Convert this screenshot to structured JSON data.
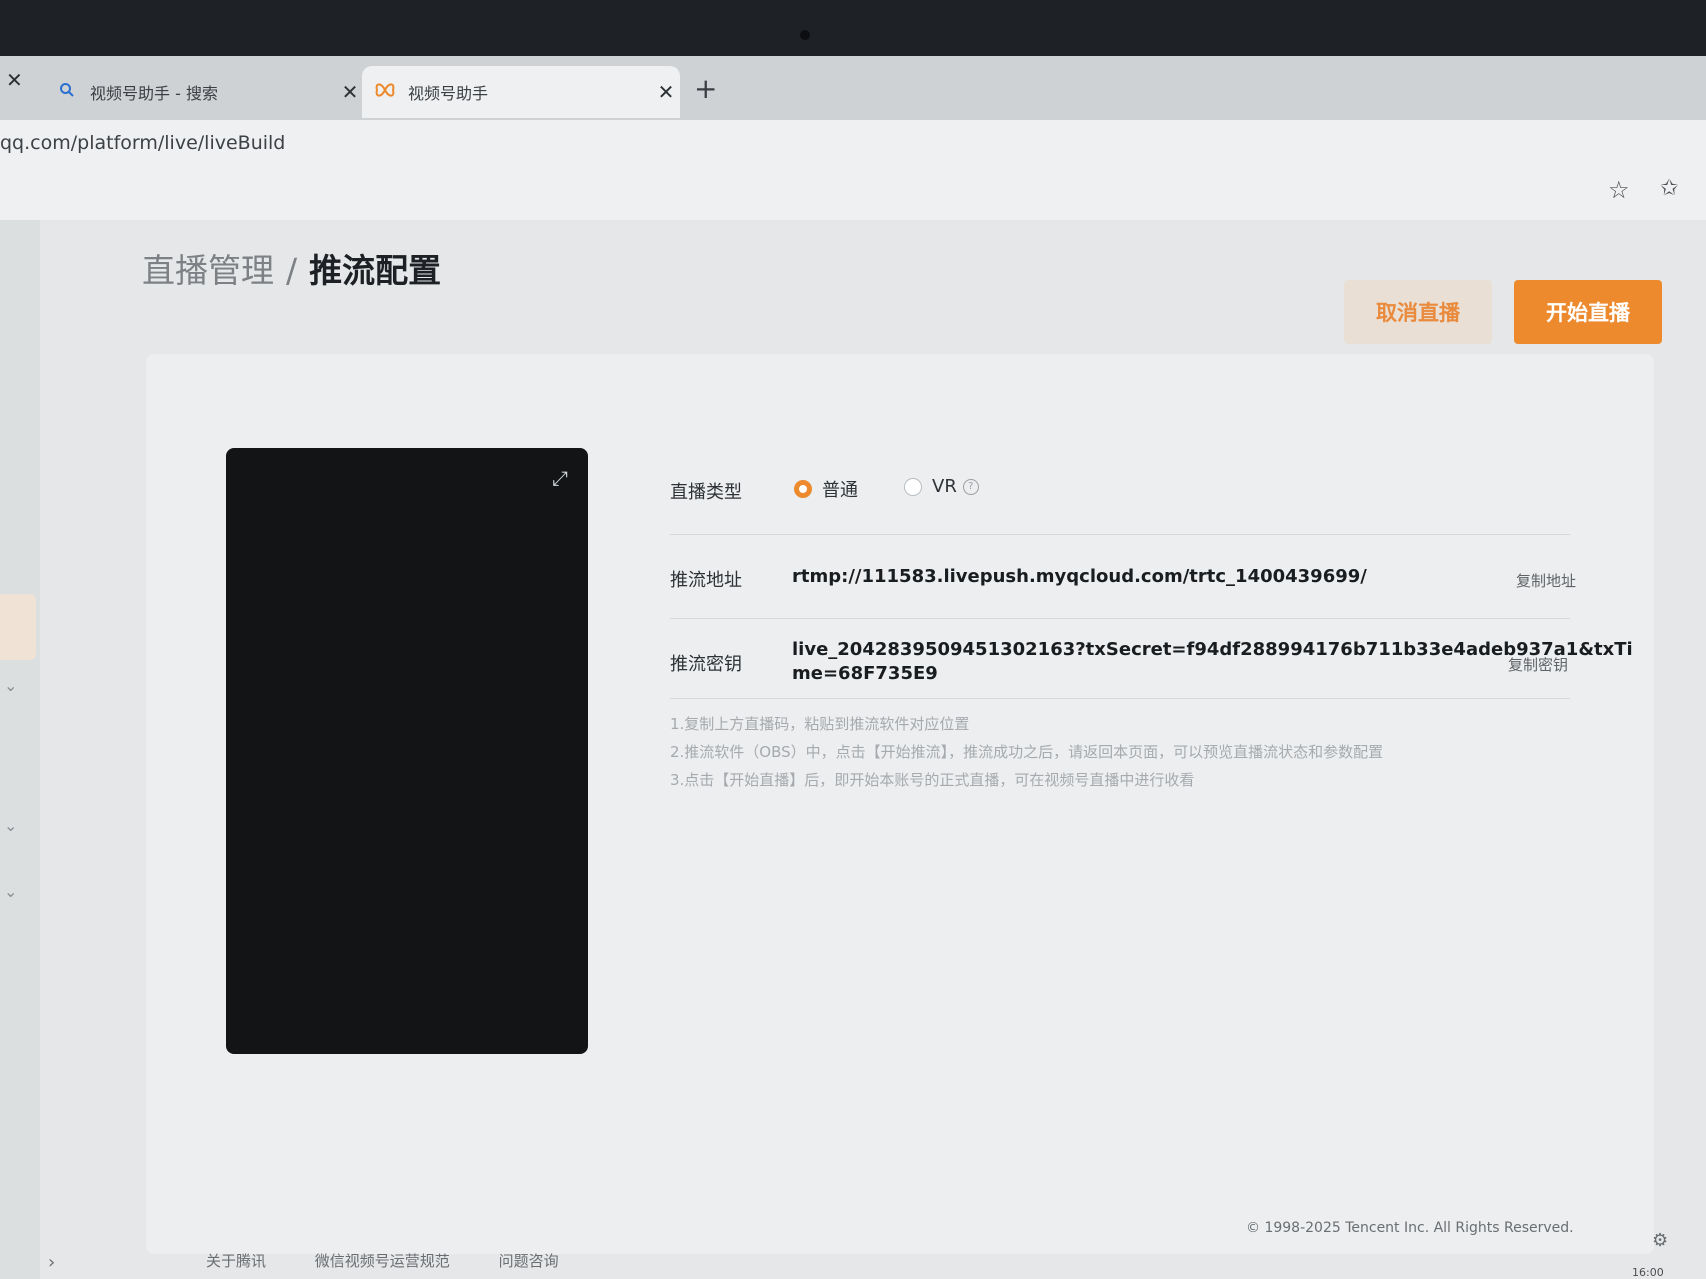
{
  "browser": {
    "tabs": [
      {
        "label": "视频号助手 - 搜索",
        "icon": "search-icon",
        "active": false
      },
      {
        "label": "视频号助手",
        "icon": "butterfly-logo-icon",
        "active": true
      }
    ],
    "url": "qq.com/platform/live/liveBuild"
  },
  "page": {
    "breadcrumb": {
      "parent": "直播管理",
      "separator": "/",
      "current": "推流配置"
    },
    "buttons": {
      "cancel": "取消直播",
      "start": "开始直播"
    },
    "live_type": {
      "label": "直播类型",
      "options": [
        {
          "label": "普通",
          "selected": true
        },
        {
          "label": "VR",
          "selected": false
        }
      ]
    },
    "push_url": {
      "label": "推流地址",
      "value": "rtmp://111583.livepush.myqcloud.com/trtc_1400439699/",
      "copy_label": "复制地址"
    },
    "push_key": {
      "label": "推流密钥",
      "value_line1": "live_2042839509451302163?txSecret=f94df288994176b711b33e4adeb937a1&txTi",
      "value_line2": "me=68F735E9",
      "copy_label": "复制密钥"
    },
    "tips": [
      "1.复制上方直播码，粘贴到推流软件对应位置",
      "2.推流软件（OBS）中，点击【开始推流】，推流成功之后，请返回本页面，可以预览直播流状态和参数配置",
      "3.点击【开始直播】后，即开始本账号的正式直播，可在视频号直播中进行收看"
    ],
    "footer": {
      "links": [
        "关于腾讯",
        "微信视频号运营规范",
        "问题咨询"
      ],
      "copyright": "© 1998-2025 Tencent Inc. All Rights Reserved."
    },
    "clock": "16:00"
  },
  "colors": {
    "accent": "#ed8a2e",
    "cancel_bg": "#e9dfd5"
  }
}
